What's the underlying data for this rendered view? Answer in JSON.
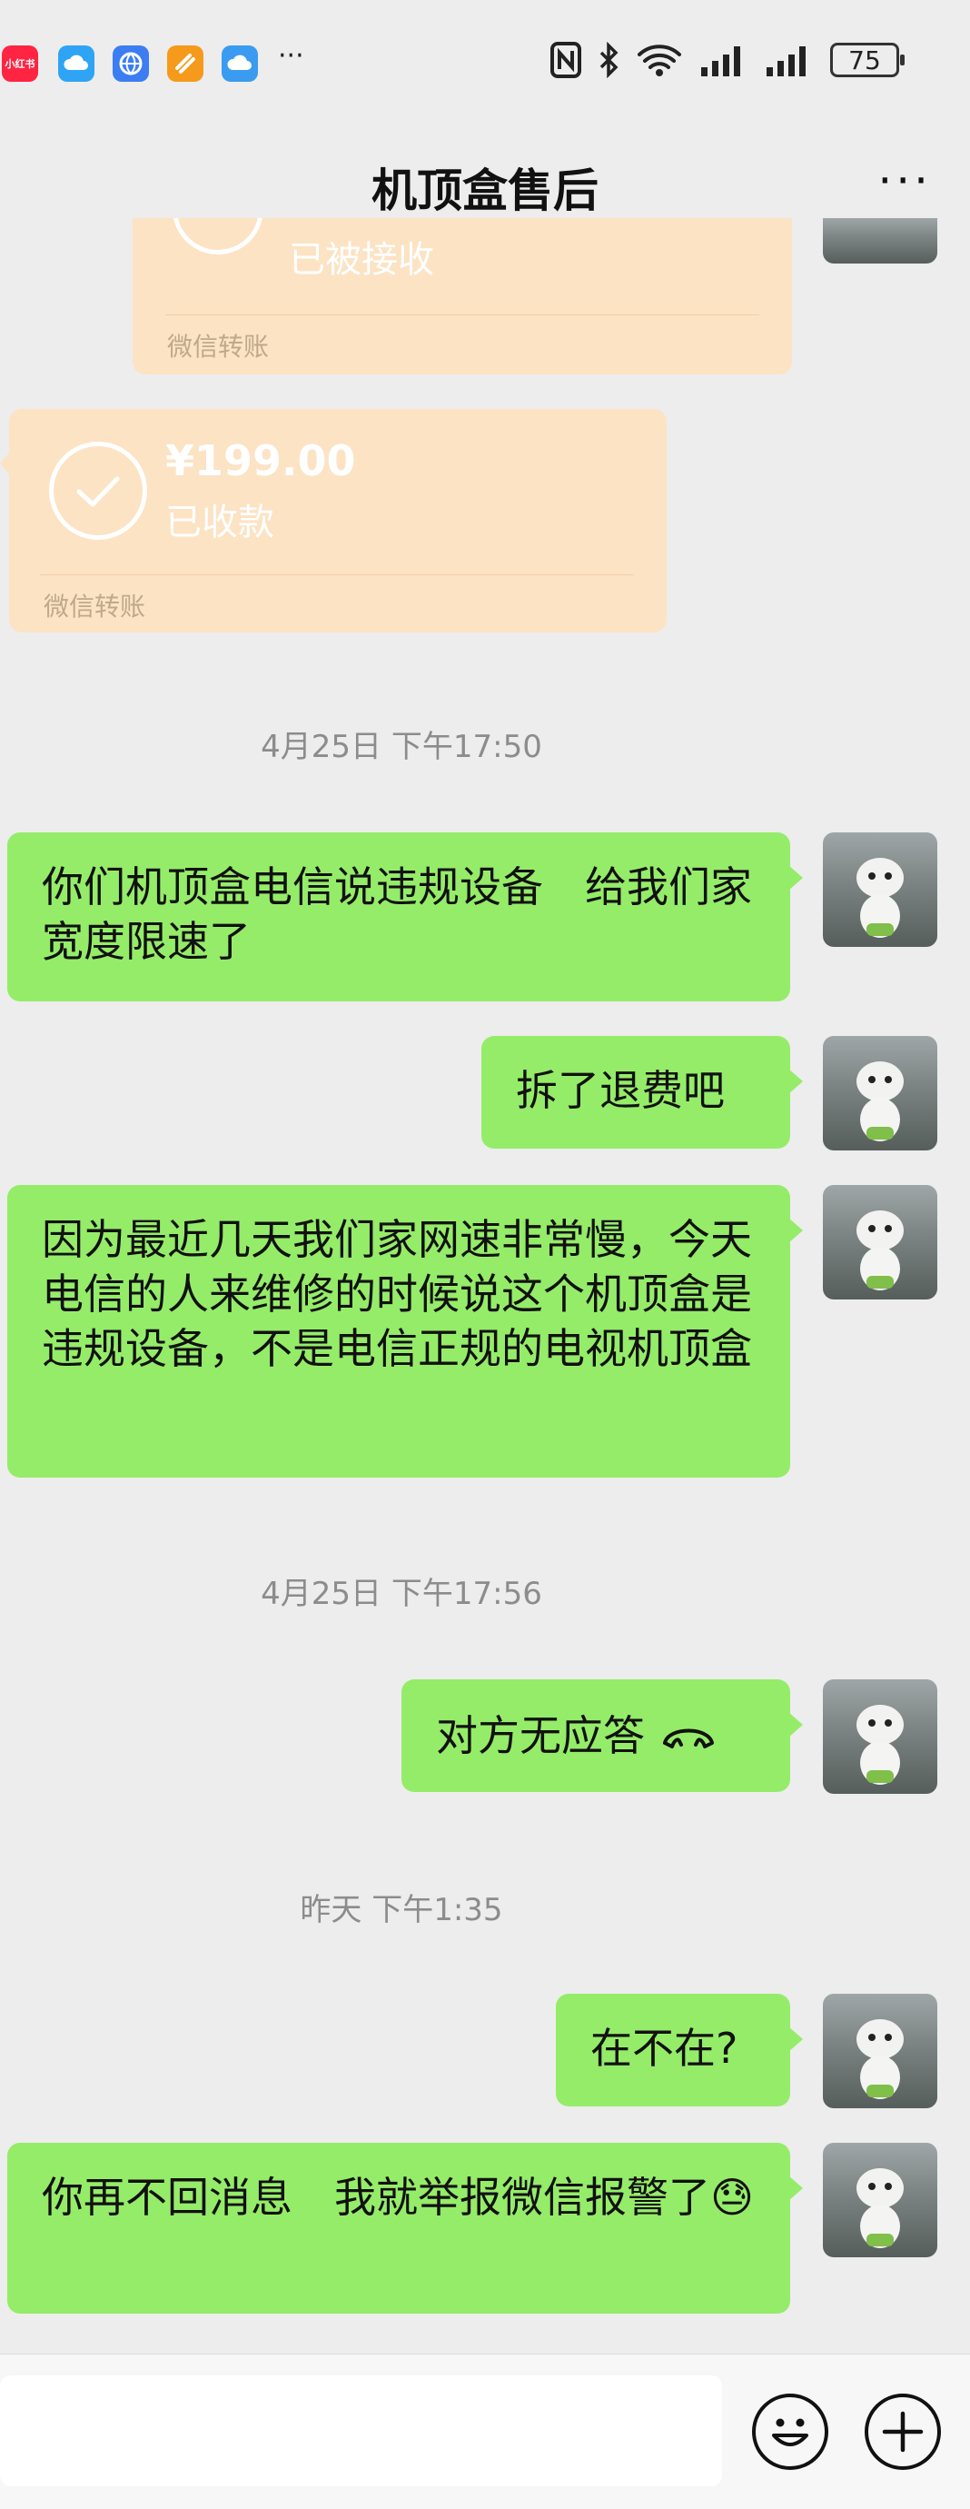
{
  "status_bar": {
    "app_icons": [
      "xiaohongshu-icon",
      "cloud-icon",
      "browser-icon",
      "app-orange-icon",
      "cloud-blue-icon"
    ],
    "xiaohongshu_text": "小红书",
    "more_dots": "···",
    "battery": "75"
  },
  "header": {
    "title": "机顶盒售后",
    "more": "···"
  },
  "messages": {
    "transfer_partial": {
      "status": "已被接收",
      "footer": "微信转账"
    },
    "transfer_1": {
      "amount": "¥199.00",
      "status": "已收款",
      "footer": "微信转账"
    },
    "ts_1": "4月25日 下午17:50",
    "msg_1": "你们机顶盒电信说违规设备　给我们家宽度限速了",
    "msg_2": "拆了退费吧",
    "msg_3": "因为最近几天我们家网速非常慢，今天电信的人来维修的时候说这个机顶盒是违规设备，不是电信正规的电视机顶盒",
    "ts_2": "4月25日 下午17:56",
    "msg_4": "对方无应答",
    "ts_3": "昨天 下午1:35",
    "msg_5": "在不在?",
    "msg_6": "你再不回消息　我就举报微信报警了😓"
  },
  "input_bar": {
    "placeholder": ""
  }
}
